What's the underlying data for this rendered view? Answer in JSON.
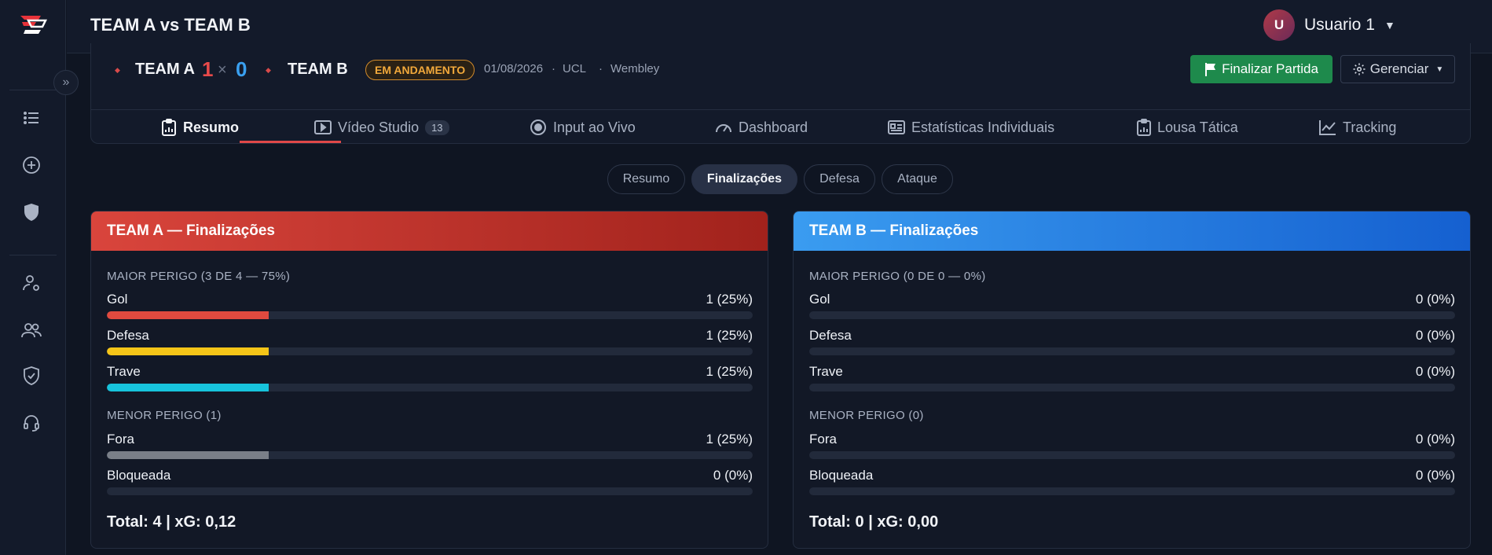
{
  "app": {
    "title": "TEAM A vs TEAM B"
  },
  "user": {
    "initial": "U",
    "name": "Usuario 1"
  },
  "match": {
    "team_a": "TEAM A",
    "score_a": "1",
    "separator": "×",
    "score_b": "0",
    "team_b": "TEAM B",
    "status": "EM ANDAMENTO",
    "date": "01/08/2026",
    "competition": "UCL",
    "venue": "Wembley",
    "dot": "·"
  },
  "actions": {
    "finish": "Finalizar Partida",
    "manage": "Gerenciar"
  },
  "tabs": [
    {
      "label": "Resumo",
      "icon": "report-icon"
    },
    {
      "label": "Vídeo Studio",
      "icon": "video-icon",
      "count": "13"
    },
    {
      "label": "Input ao Vivo",
      "icon": "record-icon"
    },
    {
      "label": "Dashboard",
      "icon": "speedometer-icon"
    },
    {
      "label": "Estatísticas Individuais",
      "icon": "id-card-icon"
    },
    {
      "label": "Lousa Tática",
      "icon": "clipboard-icon"
    },
    {
      "label": "Tracking",
      "icon": "trend-icon"
    }
  ],
  "subtabs": [
    "Resumo",
    "Finalizações",
    "Defesa",
    "Ataque"
  ],
  "colors": {
    "gol": "#e04a3f",
    "defesa": "#f5c518",
    "trave": "#17c3dc",
    "fora": "#7a7f88",
    "accent": "#e04848",
    "team_a_head": "#d9453c",
    "team_b_head": "#2f8ee8"
  },
  "panels": {
    "a": {
      "title": "TEAM A — Finalizações",
      "major_label": "MAIOR PERIGO (3 DE 4 — 75%)",
      "minor_label": "MENOR PERIGO (1)",
      "rows": [
        {
          "label": "Gol",
          "value": "1 (25%)",
          "fraction": 0.25
        },
        {
          "label": "Defesa",
          "value": "1 (25%)",
          "fraction": 0.25
        },
        {
          "label": "Trave",
          "value": "1 (25%)",
          "fraction": 0.25
        },
        {
          "label": "Fora",
          "value": "1 (25%)",
          "fraction": 0.25
        },
        {
          "label": "Bloqueada",
          "value": "0 (0%)",
          "fraction": 0
        }
      ],
      "total_label": "Total: 4",
      "sep": "|",
      "xg_label": "xG: 0,12"
    },
    "b": {
      "title": "TEAM B — Finalizações",
      "major_label": "MAIOR PERIGO (0 DE 0 — 0%)",
      "minor_label": "MENOR PERIGO (0)",
      "rows": [
        {
          "label": "Gol",
          "value": "0 (0%)",
          "fraction": 0
        },
        {
          "label": "Defesa",
          "value": "0 (0%)",
          "fraction": 0
        },
        {
          "label": "Trave",
          "value": "0 (0%)",
          "fraction": 0
        },
        {
          "label": "Fora",
          "value": "0 (0%)",
          "fraction": 0
        },
        {
          "label": "Bloqueada",
          "value": "0 (0%)",
          "fraction": 0
        }
      ],
      "total_label": "Total: 0",
      "sep": "|",
      "xg_label": "xG: 0,00"
    }
  }
}
